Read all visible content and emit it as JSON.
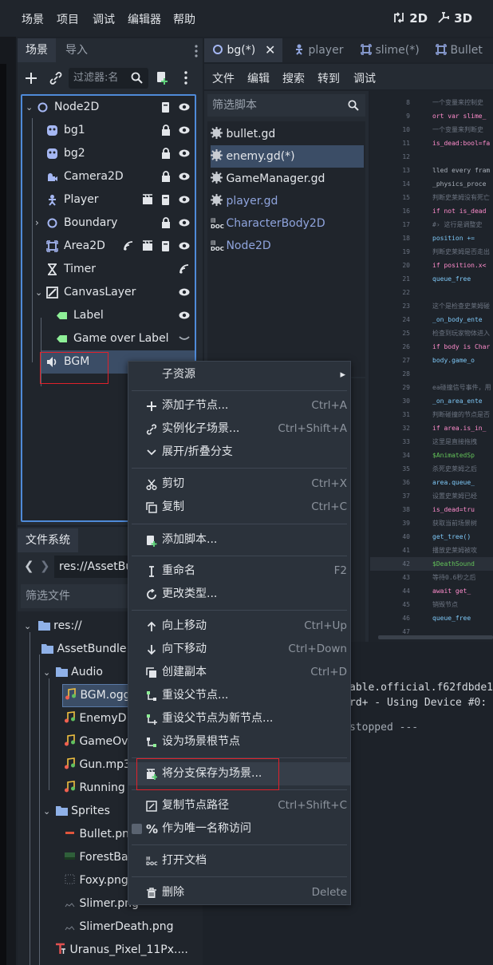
{
  "menubar": {
    "items": [
      "场景",
      "项目",
      "调试",
      "编辑器",
      "帮助"
    ],
    "view_2d": "2D",
    "view_3d": "3D"
  },
  "scene_dock": {
    "tab_scene": "场景",
    "tab_import": "导入",
    "filter_placeholder": "过滤器:名",
    "tree": [
      {
        "label": "Node2D"
      },
      {
        "label": "bg1"
      },
      {
        "label": "bg2"
      },
      {
        "label": "Camera2D"
      },
      {
        "label": "Player"
      },
      {
        "label": "Boundary"
      },
      {
        "label": "Area2D"
      },
      {
        "label": "Timer"
      },
      {
        "label": "CanvasLayer"
      },
      {
        "label": "Label"
      },
      {
        "label": "Game over Label"
      },
      {
        "label": "BGM"
      }
    ]
  },
  "filesystem": {
    "tab": "文件系统",
    "path": "res://AssetBu",
    "filter_placeholder": "筛选文件",
    "items": [
      {
        "label": "res://"
      },
      {
        "label": "AssetBundle"
      },
      {
        "label": "Audio"
      },
      {
        "label": "BGM.ogg"
      },
      {
        "label": "EnemyD"
      },
      {
        "label": "GameOv"
      },
      {
        "label": "Gun.mp3"
      },
      {
        "label": "Running"
      },
      {
        "label": "Sprites"
      },
      {
        "label": "Bullet.pn"
      },
      {
        "label": "ForestBa"
      },
      {
        "label": "Foxy.png"
      },
      {
        "label": "Slimer.png"
      },
      {
        "label": "SlimerDeath.png"
      },
      {
        "label": "Uranus_Pixel_11Px...."
      }
    ]
  },
  "editor": {
    "tabs": [
      "bg(*)",
      "player",
      "slime(*)",
      "Bullet"
    ],
    "script_menu": [
      "文件",
      "编辑",
      "搜索",
      "转到",
      "调试"
    ],
    "script_filter_placeholder": "筛选脚本",
    "scripts": [
      "bullet.gd",
      "enemy.gd(*)",
      "GameManager.gd",
      "player.gd",
      "CharacterBody2D",
      "Node2D"
    ],
    "code_lines": [
      {
        "n": "8",
        "t": "一个变量来控制史"
      },
      {
        "n": "9",
        "t": "ort var slime_"
      },
      {
        "n": "10",
        "t": "一个变量来判断史"
      },
      {
        "n": "11",
        "t": "is_dead:bool=fa"
      },
      {
        "n": "12",
        "t": ""
      },
      {
        "n": "13",
        "t": "lled every fram"
      },
      {
        "n": "14",
        "t": " _physics_proce"
      },
      {
        "n": "15",
        "t": "判断史莱姆没有死亡"
      },
      {
        "n": "16",
        "t": "if not is_dead"
      },
      {
        "n": "17",
        "t": "#› 这行是调整史"
      },
      {
        "n": "18",
        "t": "   position +="
      },
      {
        "n": "19",
        "t": "判断史莱姆是否走出"
      },
      {
        "n": "20",
        "t": "if position.x<"
      },
      {
        "n": "21",
        "t": "   queue_free"
      },
      {
        "n": "22",
        "t": ""
      },
      {
        "n": "23",
        "t": "这个是检查史莱姆碰"
      },
      {
        "n": "24",
        "t": " _on_body_ente"
      },
      {
        "n": "25",
        "t": " 检查到玩家物体进入"
      },
      {
        "n": "26",
        "t": "if body is Char"
      },
      {
        "n": "27",
        "t": "   body.game_o"
      },
      {
        "n": "28",
        "t": ""
      },
      {
        "n": "29",
        "t": "ea碰撞信号事件，用"
      },
      {
        "n": "30",
        "t": " _on_area_ente"
      },
      {
        "n": "31",
        "t": "判断碰撞的节点是否"
      },
      {
        "n": "32",
        "t": "if area.is_in_"
      },
      {
        "n": "33",
        "t": "   这里是直接拖拽"
      },
      {
        "n": "34",
        "t": "   $AnimatedSp"
      },
      {
        "n": "35",
        "t": "   杀死史莱姆之后"
      },
      {
        "n": "36",
        "t": "   area.queue_"
      },
      {
        "n": "37",
        "t": "   设置史莱姆已经"
      },
      {
        "n": "38",
        "t": "   is_dead=tru"
      },
      {
        "n": "39",
        "t": "   获取当前场景树"
      },
      {
        "n": "40",
        "t": "   get_tree()"
      },
      {
        "n": "41",
        "t": "   播放史莱姆被攻"
      },
      {
        "n": "42",
        "t": "   $DeathSound"
      },
      {
        "n": "43",
        "t": "   等待0.6秒之后"
      },
      {
        "n": "44",
        "t": "   await  get_"
      },
      {
        "n": "45",
        "t": "   销毁节点"
      },
      {
        "n": "46",
        "t": "   queue_free"
      },
      {
        "n": "47",
        "t": ""
      }
    ],
    "output_lines": [
      "able.official.f62fdbde1",
      "rd+ - Using Device #0: N",
      "stopped ---"
    ]
  },
  "context_menu": {
    "items": [
      {
        "label": "子资源",
        "shortcut": ""
      },
      {
        "label": "添加子节点...",
        "shortcut": "Ctrl+A"
      },
      {
        "label": "实例化子场景...",
        "shortcut": "Ctrl+Shift+A"
      },
      {
        "label": "展开/折叠分支",
        "shortcut": ""
      },
      {
        "label": "剪切",
        "shortcut": "Ctrl+X"
      },
      {
        "label": "复制",
        "shortcut": "Ctrl+C"
      },
      {
        "label": "添加脚本...",
        "shortcut": ""
      },
      {
        "label": "重命名",
        "shortcut": "F2"
      },
      {
        "label": "更改类型...",
        "shortcut": ""
      },
      {
        "label": "向上移动",
        "shortcut": "Ctrl+Up"
      },
      {
        "label": "向下移动",
        "shortcut": "Ctrl+Down"
      },
      {
        "label": "创建副本",
        "shortcut": "Ctrl+D"
      },
      {
        "label": "重设父节点...",
        "shortcut": ""
      },
      {
        "label": "重设父节点为新节点...",
        "shortcut": ""
      },
      {
        "label": "设为场景根节点",
        "shortcut": ""
      },
      {
        "label": "将分支保存为场景...",
        "shortcut": ""
      },
      {
        "label": "复制节点路径",
        "shortcut": "Ctrl+Shift+C"
      },
      {
        "label": "作为唯一名称访问",
        "shortcut": ""
      },
      {
        "label": "打开文档",
        "shortcut": ""
      },
      {
        "label": "删除",
        "shortcut": "Delete"
      }
    ]
  },
  "colors": {
    "accent": "#4f8ad8",
    "highlight_box": "#e0212b",
    "background": "#1d2229",
    "panel": "#252b33"
  }
}
